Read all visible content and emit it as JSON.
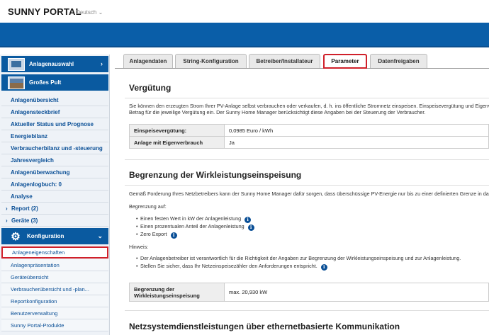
{
  "header": {
    "brand": "SUNNY PORTAL",
    "language": "Deutsch",
    "banner_color": "#0a5ea8"
  },
  "sidebar": {
    "plant_selection": "Anlagenauswahl",
    "pv_plant": "Großes Pult",
    "links": [
      "Anlagenübersicht",
      "Anlagensteckbrief",
      "Aktueller Status und Prognose",
      "Energiebilanz",
      "Verbraucherbilanz und -steuerung",
      "Jahresvergleich",
      "Anlagenüberwachung",
      "Anlagenlogbuch: 0",
      "Analyse",
      "Report (2)",
      "Geräte (3)"
    ],
    "config_header": "Konfiguration",
    "config_items": [
      "Anlageneigenschaften",
      "Anlagenpräsentation",
      "Geräteübersicht",
      "Verbraucherübersicht und -plan...",
      "Reportkonfiguration",
      "Benutzerverwaltung",
      "Sunny Portal-Produkte"
    ]
  },
  "tabs": [
    "Anlagendaten",
    "String-Konfiguration",
    "Betreiber/Installateur",
    "Parameter",
    "Datenfreigaben"
  ],
  "active_tab": "Parameter",
  "verguetung": {
    "title": "Vergütung",
    "desc_line1": "Sie können den erzeugten Strom Ihrer PV-Anlage selbst verbrauchen oder verkaufen, d. h. ins öffentliche Stromnetz einspeisen. Einspeisevergütung und Eigenv",
    "desc_line2": "Betrag für die jeweilige Vergütung ein. Der Sunny Home Manager berücksichtigt diese Angaben bei der Steuerung der Verbraucher.",
    "rows": [
      {
        "label": "Einspeisevergütung:",
        "value": "0,0985 Euro / kWh"
      },
      {
        "label": "Anlage mit Eigenverbrauch",
        "value": "Ja"
      }
    ]
  },
  "begrenzung": {
    "title": "Begrenzung der Wirkleistungseinspeisung",
    "desc": "Gemäß Forderung Ihres Netzbetreibers kann der Sunny Home Manager dafür sorgen, dass überschüssige PV-Energie nur bis zu einer definierten Grenze in das N",
    "limit_on": "Begrenzung auf:",
    "options": [
      "Einen festen Wert in kW der Anlagenleistung",
      "Einen prozentualen Anteil der Anlagenleistung",
      "Zero Export"
    ],
    "hint_label": "Hinweis:",
    "hints": [
      "Der Anlagenbetreiber ist verantwortlich für die Richtigkeit der Angaben zur Begrenzung der Wirkleistungseinspeisung und zur Anlagenleistung.",
      "Stellen Sie sicher, dass Ihr Netzeinspeisezähler den Anforderungen entspricht."
    ],
    "row_label_1": "Begrenzung der",
    "row_label_2": "Wirkleistungseinspeisung",
    "row_value": "max. 20,930 kW"
  },
  "netz": {
    "title": "Netzsystemdienstleistungen über ethernetbasierte Kommunikation"
  },
  "info_icon_glyph": "i"
}
